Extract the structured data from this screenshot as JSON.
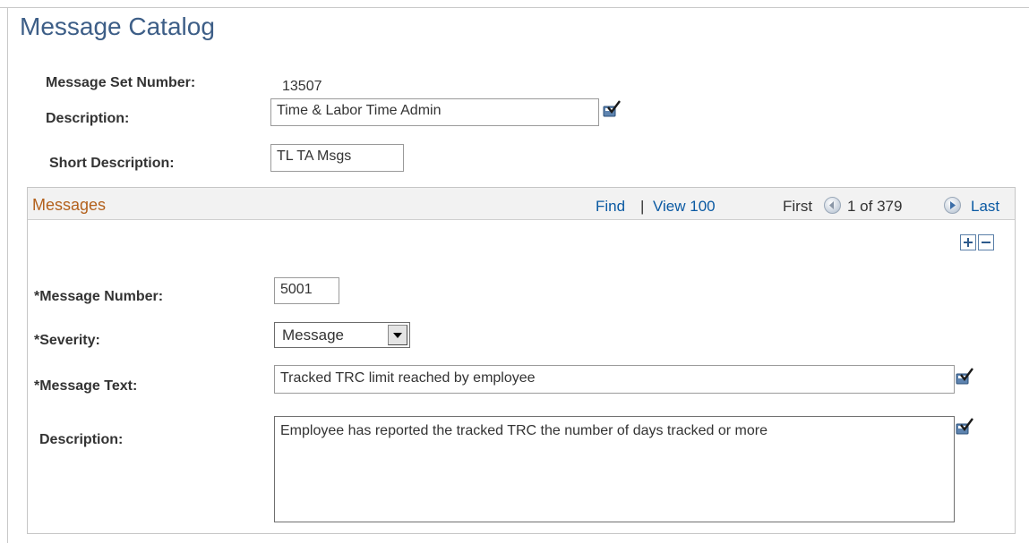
{
  "page": {
    "title": "Message Catalog"
  },
  "header": {
    "message_set_number_label": "Message Set Number:",
    "message_set_number_value": "13507",
    "description_label": "Description:",
    "description_value": "Time & Labor Time Admin",
    "short_description_label": "Short Description:",
    "short_description_value": "TL TA Msgs"
  },
  "messages": {
    "title": "Messages",
    "find_label": "Find",
    "separator": "|",
    "view_label": "View 100",
    "first_label": "First",
    "pagination": "1 of 379",
    "last_label": "Last",
    "message_number_label": "*Message Number:",
    "message_number_value": "5001",
    "severity_label": "*Severity:",
    "severity_value": "Message",
    "message_text_label": "*Message Text:",
    "message_text_value": "Tracked TRC limit reached by employee",
    "description_label": "Description:",
    "description_value": "Employee has reported the tracked TRC the number of days tracked or more"
  },
  "icons": {
    "spellcheck": "spell-check-icon",
    "prev": "previous-arrow-icon",
    "next": "next-arrow-icon",
    "add_row": "add-row-icon",
    "delete_row": "delete-row-icon"
  },
  "colors": {
    "title": "#3d5e87",
    "group_title": "#b3611d",
    "link": "#0b5aa3",
    "border": "#9a9a9a"
  }
}
